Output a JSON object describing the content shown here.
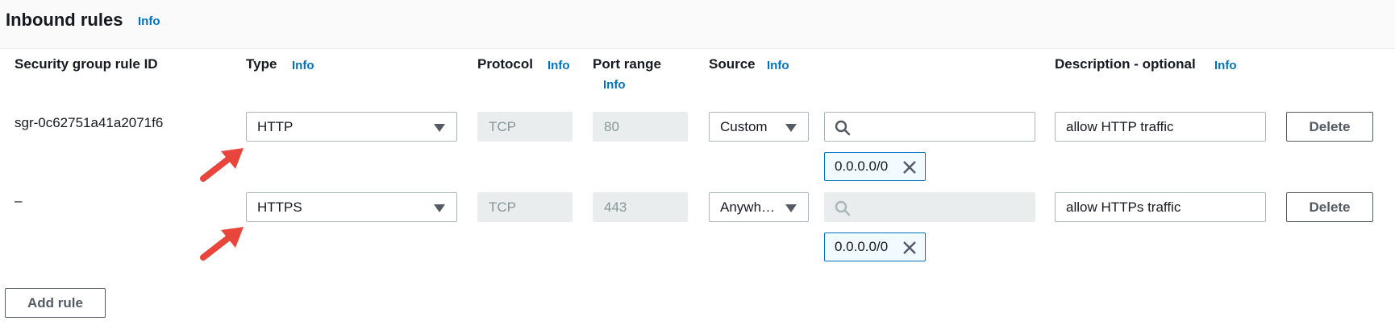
{
  "header": {
    "title": "Inbound rules",
    "info": "Info"
  },
  "columns": {
    "rule_id": "Security group rule ID",
    "type": "Type",
    "type_info": "Info",
    "protocol": "Protocol",
    "protocol_info": "Info",
    "port_range": "Port range",
    "port_range_info": "Info",
    "source": "Source",
    "source_info": "Info",
    "description": "Description - optional",
    "description_info": "Info"
  },
  "rules": [
    {
      "rule_id": "sgr-0c62751a41a2071f6",
      "type": "HTTP",
      "protocol": "TCP",
      "port_range": "80",
      "source": "Custom",
      "search_value": "",
      "cidr_token": "0.0.0.0/0",
      "description": "allow HTTP traffic",
      "delete_label": "Delete"
    },
    {
      "rule_id": "–",
      "type": "HTTPS",
      "protocol": "TCP",
      "port_range": "443",
      "source": "Anywh…",
      "search_value": "",
      "cidr_token": "0.0.0.0/0",
      "description": "allow HTTPs traffic",
      "delete_label": "Delete"
    }
  ],
  "add_rule_label": "Add rule",
  "colors": {
    "link": "#0073bb",
    "annotation_arrow": "#e8453c",
    "disabled_bg": "#eaeded"
  }
}
